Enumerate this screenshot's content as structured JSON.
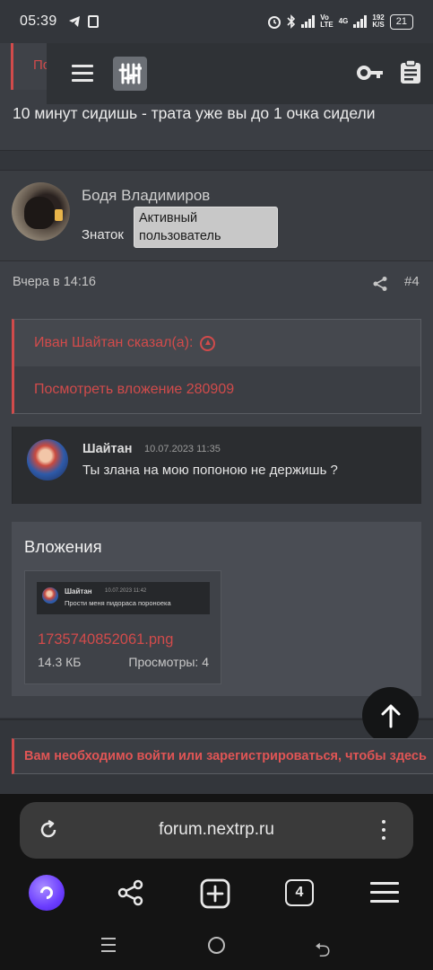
{
  "status_bar": {
    "time": "05:39",
    "net_rate_top": "192",
    "net_rate_bottom": "K/S",
    "volte_top": "Vo",
    "volte_bottom": "LTE",
    "network": "4G",
    "battery": "21",
    "icons": [
      "telegram-icon",
      "sim-icon",
      "alarm-icon",
      "bluetooth-icon",
      "signal-icon",
      "battery-icon"
    ]
  },
  "forum_header": {
    "icons": [
      "menu-icon",
      "logo-icon",
      "key-icon",
      "clipboard-icon"
    ]
  },
  "previous_post": {
    "quote_fragment": "По",
    "text": "10 минут сидишь - трата уже вы до 1 очка сидели"
  },
  "post": {
    "username": "Бодя Владимиров",
    "user_title": "Знаток",
    "user_badge": "Активный пользователь",
    "date": "Вчера в 14:16",
    "number": "#4",
    "quote": {
      "header": "Иван Шайтан сказал(а):",
      "link": "Посмотреть вложение 280909"
    },
    "embed": {
      "name": "Шайтан",
      "date": "10.07.2023 11:35",
      "text": "Ты злана на мою попоною не держишь ?"
    },
    "attachments": {
      "title": "Вложения",
      "thumbnail": {
        "name": "Шайтан",
        "date": "10.07.2023 11:42",
        "text": "Прости меня пидораса пороноека"
      },
      "file_name": "1735740852061.png",
      "file_size": "14.3 КБ",
      "views": "Просмотры: 4"
    }
  },
  "login_notice": "Вам необходимо войти или зарегистрироваться, чтобы здесь",
  "browser": {
    "url": "forum.nextrp.ru",
    "tab_count": "4",
    "icons": [
      "reload-icon",
      "kebab-menu-icon",
      "alice-icon",
      "share-icon",
      "new-tab-icon",
      "tabs-icon",
      "menu-icon"
    ]
  },
  "colors": {
    "accent_red": "#d14b4b",
    "page_bg": "#33363b",
    "browser_bg": "#141414"
  }
}
